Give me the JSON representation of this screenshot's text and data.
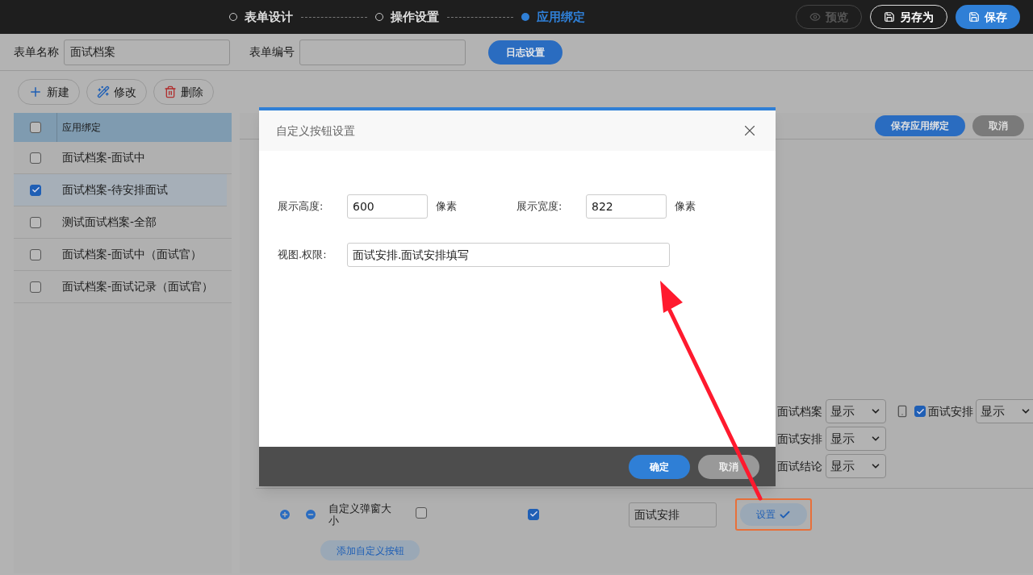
{
  "steps": [
    {
      "label": "表单设计",
      "selected": false
    },
    {
      "label": "操作设置",
      "selected": false
    },
    {
      "label": "应用绑定",
      "selected": true
    }
  ],
  "top_actions": [
    {
      "label": "预览",
      "kind": "preview",
      "disabled": true
    },
    {
      "label": "另存为",
      "kind": "outline",
      "disabled": false
    },
    {
      "label": "保存",
      "kind": "primary",
      "disabled": false
    }
  ],
  "form": {
    "fields": [
      {
        "label": "表单名称",
        "value": "面试档案"
      },
      {
        "label": "表单编号"
      }
    ],
    "log_button": "日志设置"
  },
  "toolbar": [
    {
      "label": "新建",
      "kind": "add"
    },
    {
      "label": "修改",
      "kind": "edit"
    },
    {
      "label": "删除",
      "kind": "delete"
    }
  ],
  "list": {
    "header": {
      "label": "应用绑定",
      "checked": false
    },
    "rows": [
      {
        "label": "面试档案-面试中",
        "checked": false,
        "selected": false
      },
      {
        "label": "面试档案-待安排面试",
        "checked": true,
        "selected": true
      },
      {
        "label": "测试面试档案-全部",
        "checked": false,
        "selected": false
      },
      {
        "label": "面试档案-面试中（面试官）",
        "checked": false,
        "selected": false
      },
      {
        "label": "面试档案-面试记录（面试官）",
        "checked": false,
        "selected": false
      }
    ]
  },
  "panel": {
    "buttons": [
      {
        "label": "保存应用绑定",
        "kind": "primary"
      },
      {
        "label": "取消",
        "kind": "secondary"
      }
    ],
    "permissions": [
      {
        "label": "面试档案",
        "value": "显示"
      },
      {
        "label": "面试安排",
        "value": "显示"
      },
      {
        "label": "面试结论",
        "value": "显示"
      }
    ],
    "mobile_permission": {
      "checked": true,
      "label": "面试安排",
      "value": "显示"
    },
    "custom_button": {
      "label": "自定义弹窗大小",
      "check_1": false,
      "check_2": true,
      "name_value": "面试安排",
      "set_button": "设置",
      "highlighted": true
    },
    "add_button": "添加自定义按钮"
  },
  "modal": {
    "title": "自定义按钮设置",
    "size_fields": [
      {
        "label": "展示高度:",
        "value": "600",
        "unit": "像素"
      },
      {
        "label": "展示宽度:",
        "value": "822",
        "unit": "像素"
      }
    ],
    "view_field": {
      "label": "视图.权限:",
      "value": "面试安排.面试安排填写"
    },
    "buttons": [
      {
        "label": "确定",
        "kind": "primary"
      },
      {
        "label": "取消",
        "kind": "secondary"
      }
    ]
  }
}
